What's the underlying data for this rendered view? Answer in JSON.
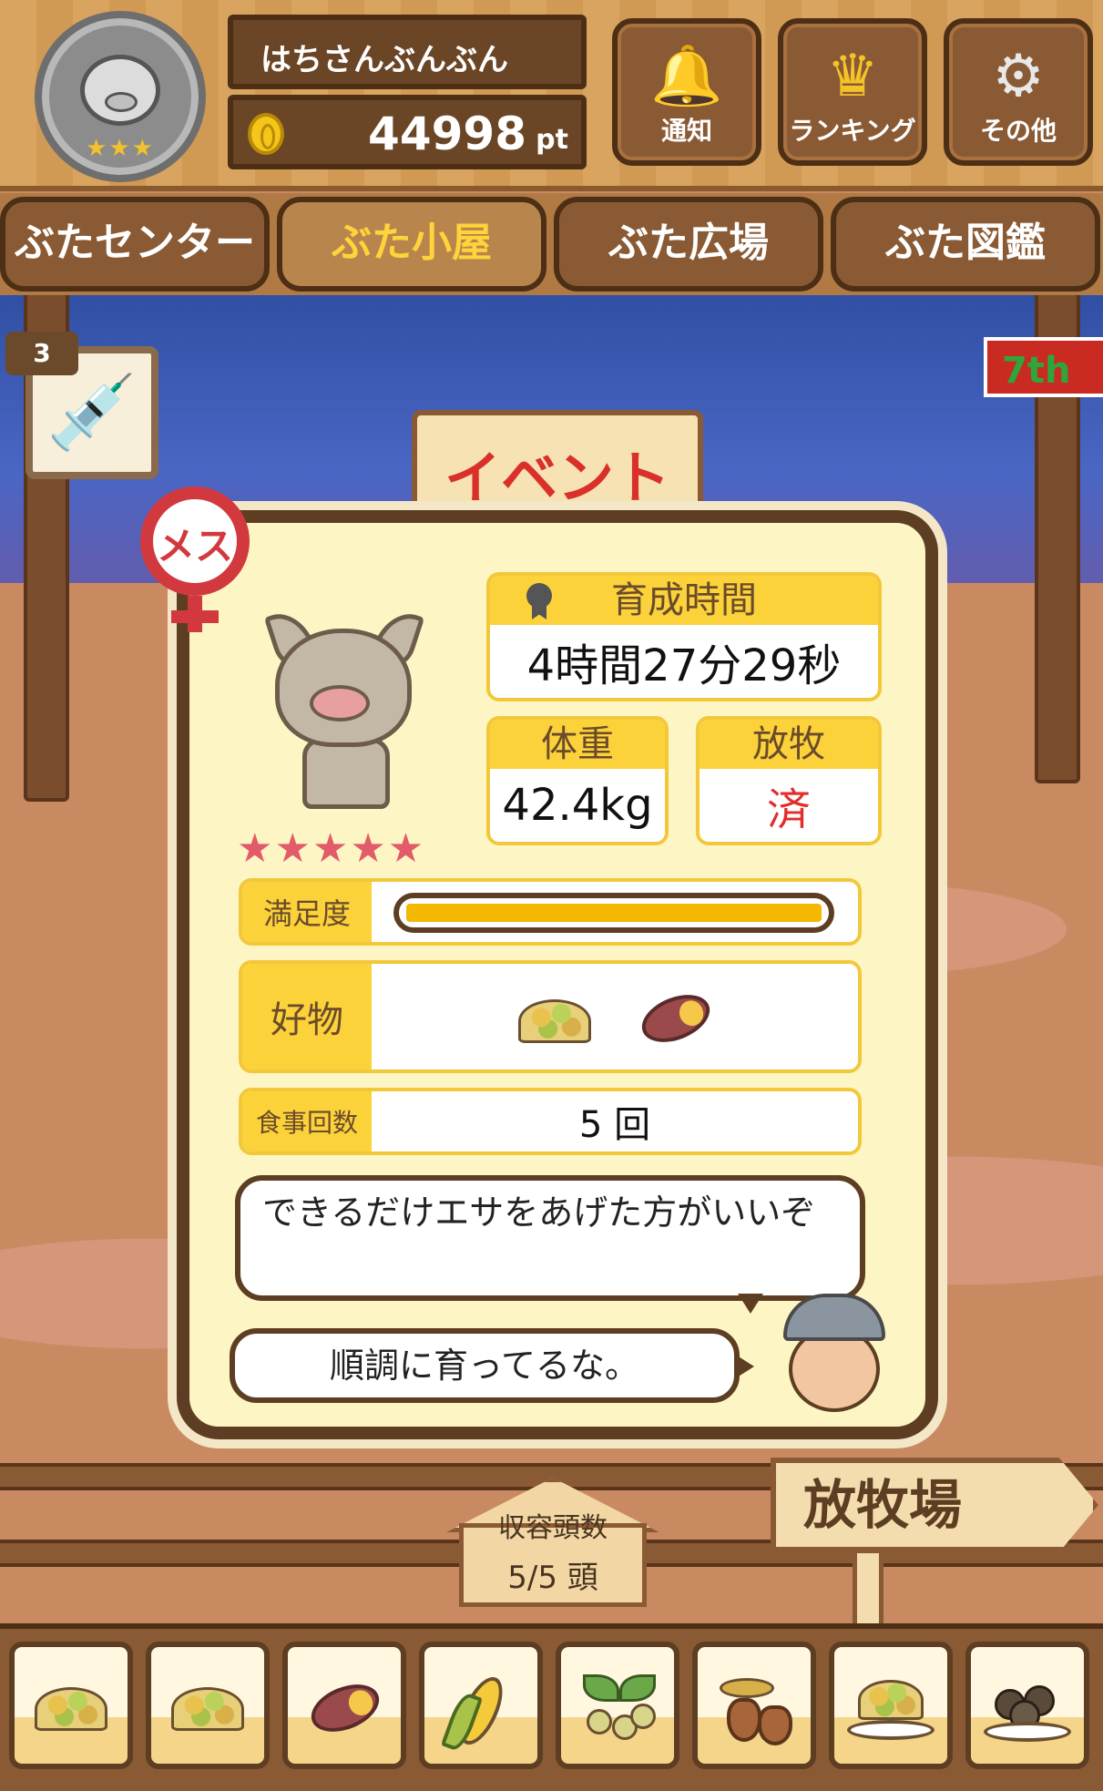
{
  "player": {
    "name": "はちさんぶんぶん",
    "points": "44998",
    "points_unit": "pt",
    "rank_stars": "★★★"
  },
  "top_buttons": [
    {
      "label": "通知",
      "icon": "bell-icon"
    },
    {
      "label": "ランキング",
      "icon": "crown-icon"
    },
    {
      "label": "その他",
      "icon": "gear-icon"
    }
  ],
  "tabs": [
    {
      "label": "ぶたセンター",
      "active": false
    },
    {
      "label": "ぶた小屋",
      "active": true
    },
    {
      "label": "ぶた広場",
      "active": false
    },
    {
      "label": "ぶた図鑑",
      "active": false
    }
  ],
  "event": {
    "banner_text": "イベント",
    "sign_text": "7th"
  },
  "syringe": {
    "count": "3",
    "icon": "syringe-icon"
  },
  "pig": {
    "gender_label": "メス",
    "rarity_stars": "★★★★★",
    "raise_time_label": "育成時間",
    "raise_time_value": "4時間27分29秒",
    "weight_label": "体重",
    "weight_value": "42.4kg",
    "grazing_label": "放牧",
    "grazing_value": "済",
    "satisfaction_label": "満足度",
    "satisfaction_level": 1.0,
    "favorite_label": "好物",
    "favorite_foods": [
      "grain-pile-icon",
      "sweet-potato-icon"
    ],
    "meals_label": "食事回数",
    "meals_value": "5 回"
  },
  "dialogue": {
    "line_1": "できるだけエサをあげた方がいいぞ",
    "line_2": "順調に育ってるな。"
  },
  "capacity": {
    "label": "収容頭数",
    "value": "5/5 頭"
  },
  "pasture_sign": "放牧場",
  "food_bar": [
    "grain-pile-icon",
    "mixed-grain-icon",
    "sweet-potato-icon",
    "corn-icon",
    "beans-leaf-icon",
    "acorn-icon",
    "grain-plate-icon",
    "chestnut-plate-icon"
  ],
  "colors": {
    "accent_yellow": "#fbd23a",
    "frame_brown": "#5d3e22",
    "panel_cream": "#fdf6c4",
    "female_red": "#d2393f",
    "done_red": "#e22d2d"
  }
}
